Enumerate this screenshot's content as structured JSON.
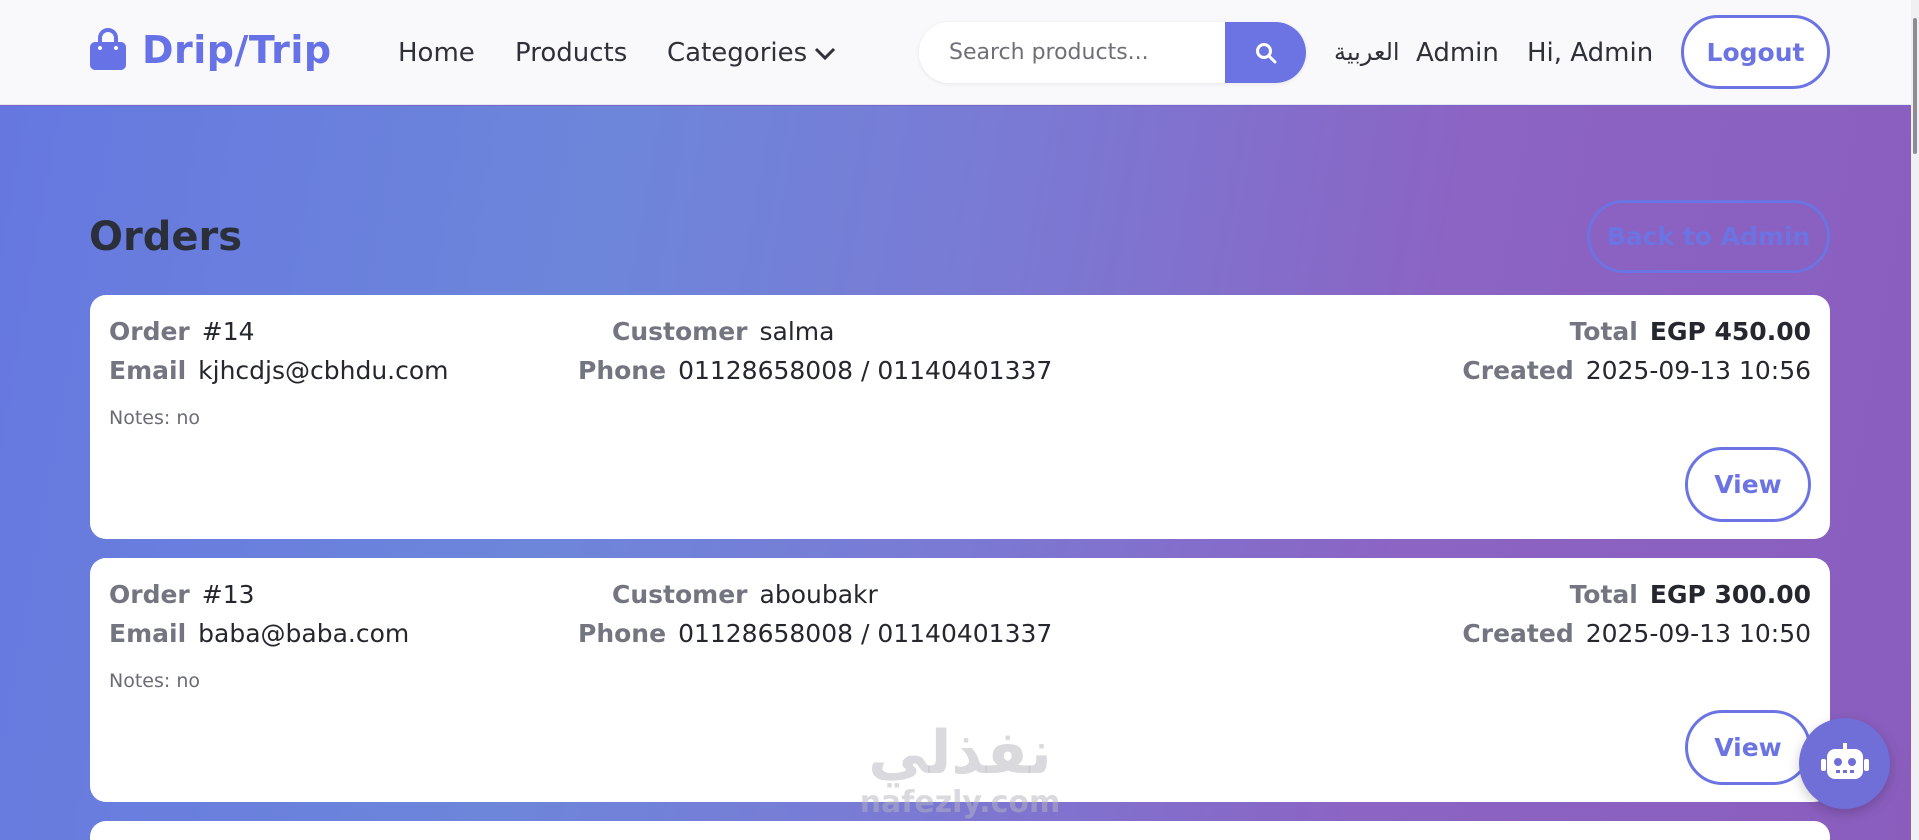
{
  "navbar": {
    "brand": "Drip/Trip",
    "links": {
      "home": "Home",
      "products": "Products",
      "categories": "Categories"
    },
    "search": {
      "placeholder": "Search products..."
    },
    "language": "العربية",
    "admin": "Admin",
    "greeting": "Hi, Admin",
    "logout": "Logout"
  },
  "page": {
    "title": "Orders",
    "back_button": "Back to Admin"
  },
  "labels": {
    "order": "Order",
    "email": "Email",
    "customer": "Customer",
    "phone": "Phone",
    "total": "Total",
    "created": "Created",
    "view": "View"
  },
  "orders": [
    {
      "number": "#14",
      "email": "kjhcdjs@cbhdu.com",
      "customer": "salma",
      "phone": "01128658008 / 01140401337",
      "total": "EGP 450.00",
      "created": "2025-09-13 10:56",
      "notes": "Notes: no"
    },
    {
      "number": "#13",
      "email": "baba@baba.com",
      "customer": "aboubakr",
      "phone": "01128658008 / 01140401337",
      "total": "EGP 300.00",
      "created": "2025-09-13 10:50",
      "notes": "Notes: no"
    }
  ],
  "watermark": {
    "arabic": "نفذلي",
    "latin": "nafezly.com"
  },
  "icons": {
    "brand": "shopping-bag-icon",
    "categories": "chevron-down-icon",
    "search": "search-icon",
    "assistant": "robot-icon"
  },
  "colors": {
    "accent": "#6b74e2",
    "gradient_start": "#6678e0",
    "gradient_end": "#8a5dbd"
  }
}
